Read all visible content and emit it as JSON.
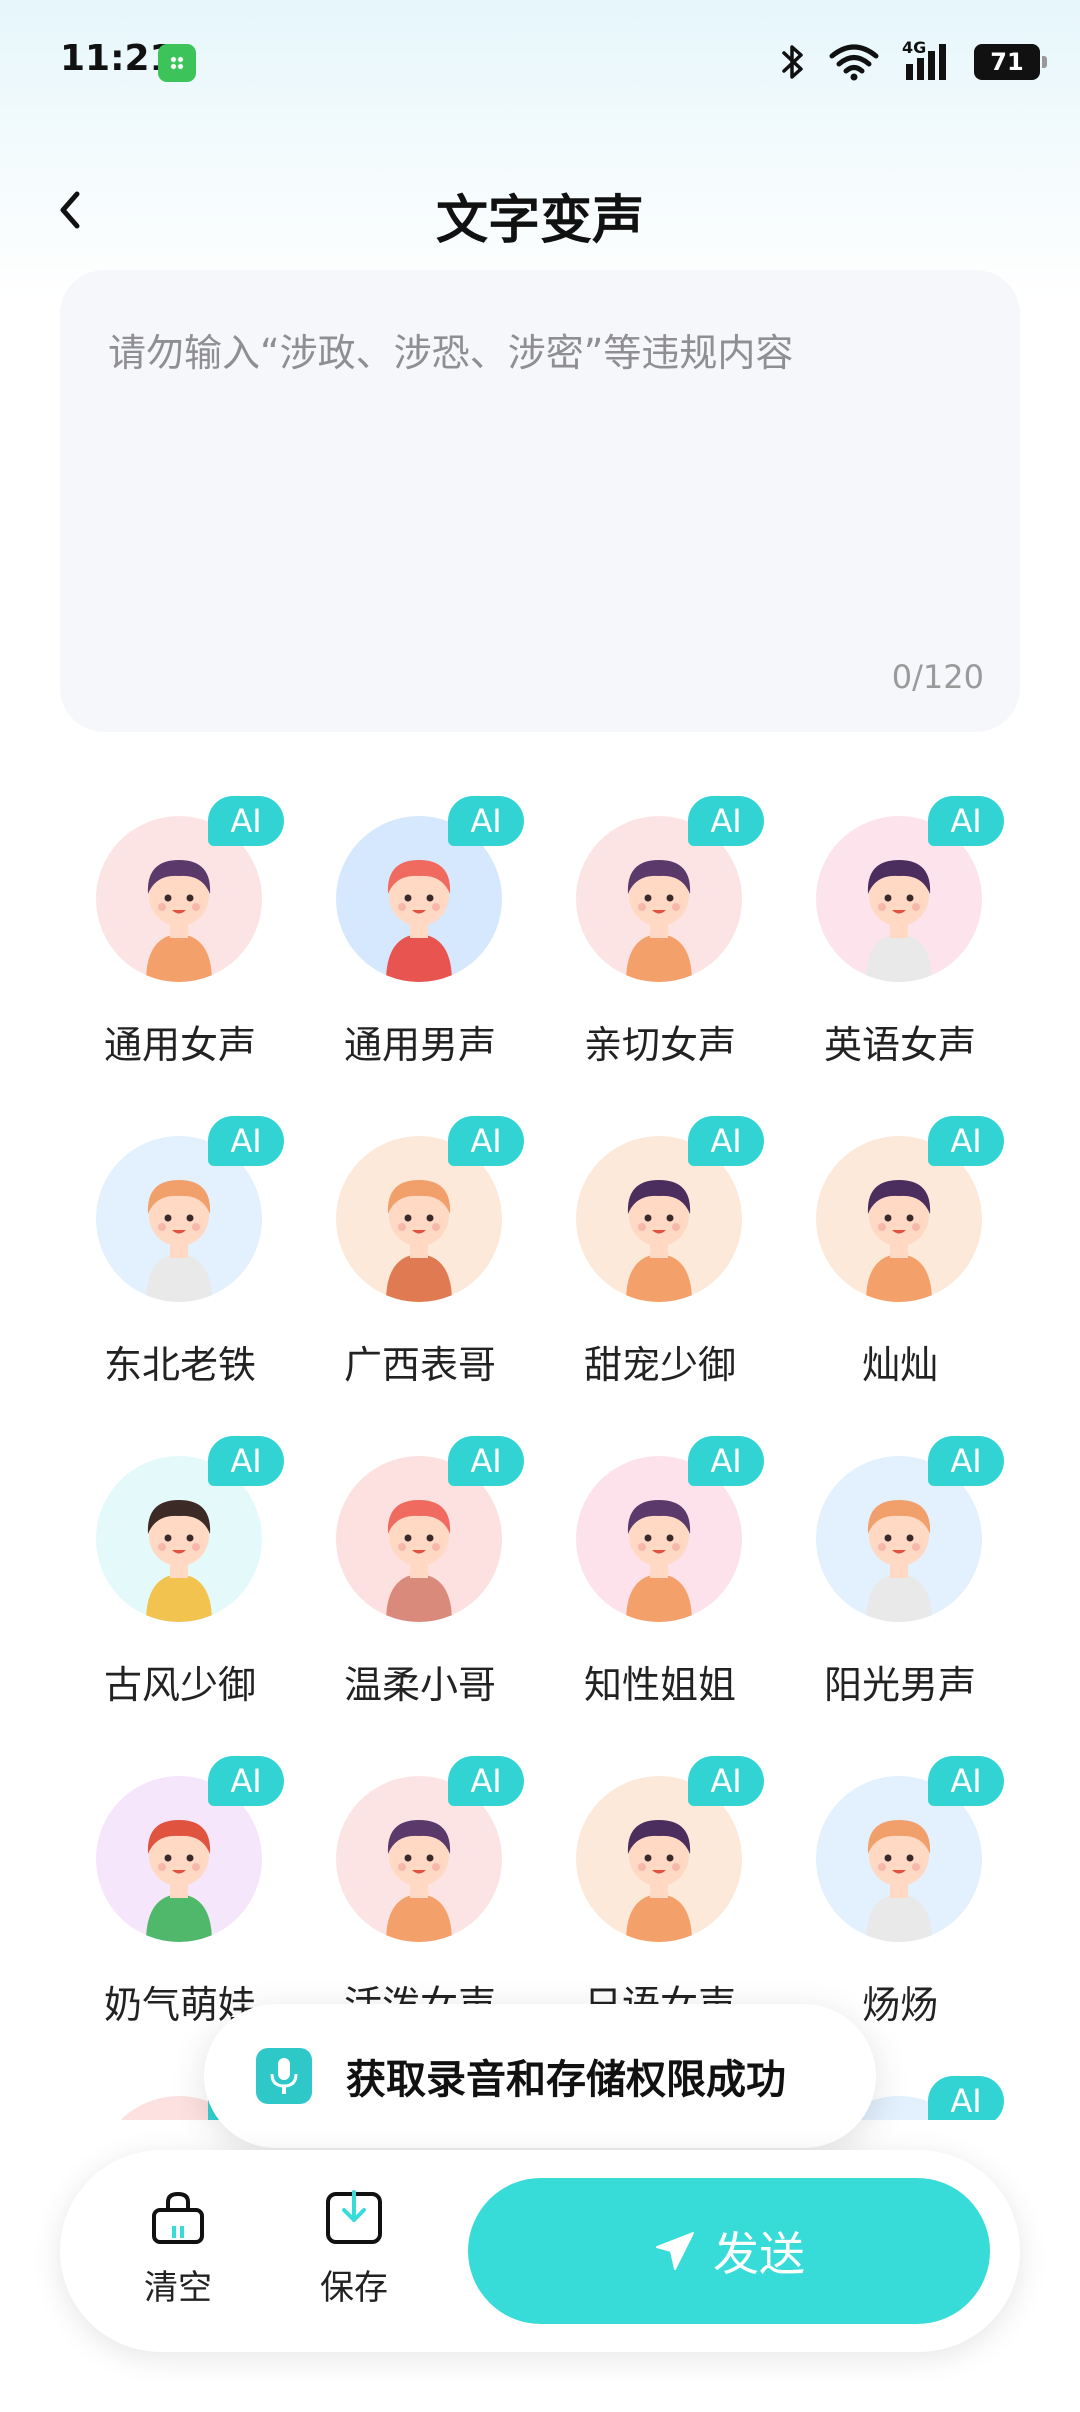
{
  "status_bar": {
    "time": "11:21",
    "network": "4G",
    "battery": "71"
  },
  "header": {
    "title": "文字变声"
  },
  "editor": {
    "placeholder": "请勿输入“涉政、涉恐、涉密”等违规内容",
    "value": "",
    "counter": "0/120"
  },
  "voices": [
    {
      "name": "通用女声",
      "badge": "AI",
      "bg": "#fde4e4",
      "hair": "#5b3a6b",
      "skin": "#ffd9c4",
      "shirt": "#f4a06a"
    },
    {
      "name": "通用男声",
      "badge": "AI",
      "bg": "#d6e8fd",
      "hair": "#f06a5f",
      "skin": "#ffd9c4",
      "shirt": "#e8544f"
    },
    {
      "name": "亲切女声",
      "badge": "AI",
      "bg": "#fde4e4",
      "hair": "#5b3a6b",
      "skin": "#ffd9c4",
      "shirt": "#f4a06a"
    },
    {
      "name": "英语女声",
      "badge": "AI",
      "bg": "#fde4ec",
      "hair": "#4b2d5e",
      "skin": "#ffd9c4",
      "shirt": "#e9e9e9"
    },
    {
      "name": "东北老铁",
      "badge": "AI",
      "bg": "#e3f0fd",
      "hair": "#f2a06b",
      "skin": "#ffd9c4",
      "shirt": "#e9e9e9"
    },
    {
      "name": "广西表哥",
      "badge": "AI",
      "bg": "#fde9d9",
      "hair": "#f2a06b",
      "skin": "#ffd9c4",
      "shirt": "#e07a52"
    },
    {
      "name": "甜宠少御",
      "badge": "AI",
      "bg": "#fde9d9",
      "hair": "#4b2d5e",
      "skin": "#ffd9c4",
      "shirt": "#f4a06a"
    },
    {
      "name": "灿灿",
      "badge": "AI",
      "bg": "#fde9d9",
      "hair": "#4b2d5e",
      "skin": "#ffd9c4",
      "shirt": "#f4a06a"
    },
    {
      "name": "古风少御",
      "badge": "AI",
      "bg": "#e4f9f9",
      "hair": "#3b2a25",
      "skin": "#ffd9c4",
      "shirt": "#f2c34e"
    },
    {
      "name": "温柔小哥",
      "badge": "AI",
      "bg": "#fde0e0",
      "hair": "#f06a5f",
      "skin": "#ffd9c4",
      "shirt": "#d98a7a"
    },
    {
      "name": "知性姐姐",
      "badge": "AI",
      "bg": "#fde2ec",
      "hair": "#5b3a6b",
      "skin": "#ffd9c4",
      "shirt": "#f4a06a"
    },
    {
      "name": "阳光男声",
      "badge": "AI",
      "bg": "#e3f0fd",
      "hair": "#f2a06b",
      "skin": "#ffd9c4",
      "shirt": "#e9e9e9"
    },
    {
      "name": "奶气萌娃",
      "badge": "AI",
      "bg": "#f6e6fb",
      "hair": "#e0533e",
      "skin": "#ffd9c4",
      "shirt": "#4fb86a"
    },
    {
      "name": "活泼女声",
      "badge": "AI",
      "bg": "#fde4e4",
      "hair": "#5b3a6b",
      "skin": "#ffd9c4",
      "shirt": "#f4a06a"
    },
    {
      "name": "日语女声",
      "badge": "AI",
      "bg": "#fde9d9",
      "hair": "#4b2d5e",
      "skin": "#ffd9c4",
      "shirt": "#f4a06a"
    },
    {
      "name": "炀炀",
      "badge": "AI",
      "bg": "#e3f0fd",
      "hair": "#f2a06b",
      "skin": "#ffd9c4",
      "shirt": "#e9e9e9"
    },
    {
      "name": "",
      "badge": "AI",
      "bg": "#fde0e0",
      "hair": "#f06a5f",
      "skin": "#ffd9c4",
      "shirt": "#e8544f"
    },
    {
      "name": "",
      "badge": "AI",
      "bg": "#fde4e4",
      "hair": "#5b3a6b",
      "skin": "#ffd9c4",
      "shirt": "#f4a06a"
    },
    {
      "name": "",
      "badge": "AI",
      "bg": "#fde9d9",
      "hair": "#4b2d5e",
      "skin": "#ffd9c4",
      "shirt": "#f4a06a"
    },
    {
      "name": "",
      "badge": "AI",
      "bg": "#e3f0fd",
      "hair": "#f2a06b",
      "skin": "#ffd9c4",
      "shirt": "#e9e9e9"
    }
  ],
  "toast": {
    "message": "获取录音和存储权限成功"
  },
  "bottom_bar": {
    "clear_label": "清空",
    "save_label": "保存",
    "send_label": "发送"
  },
  "colors": {
    "accent": "#37dcd8",
    "badge": "#32d4d3"
  }
}
